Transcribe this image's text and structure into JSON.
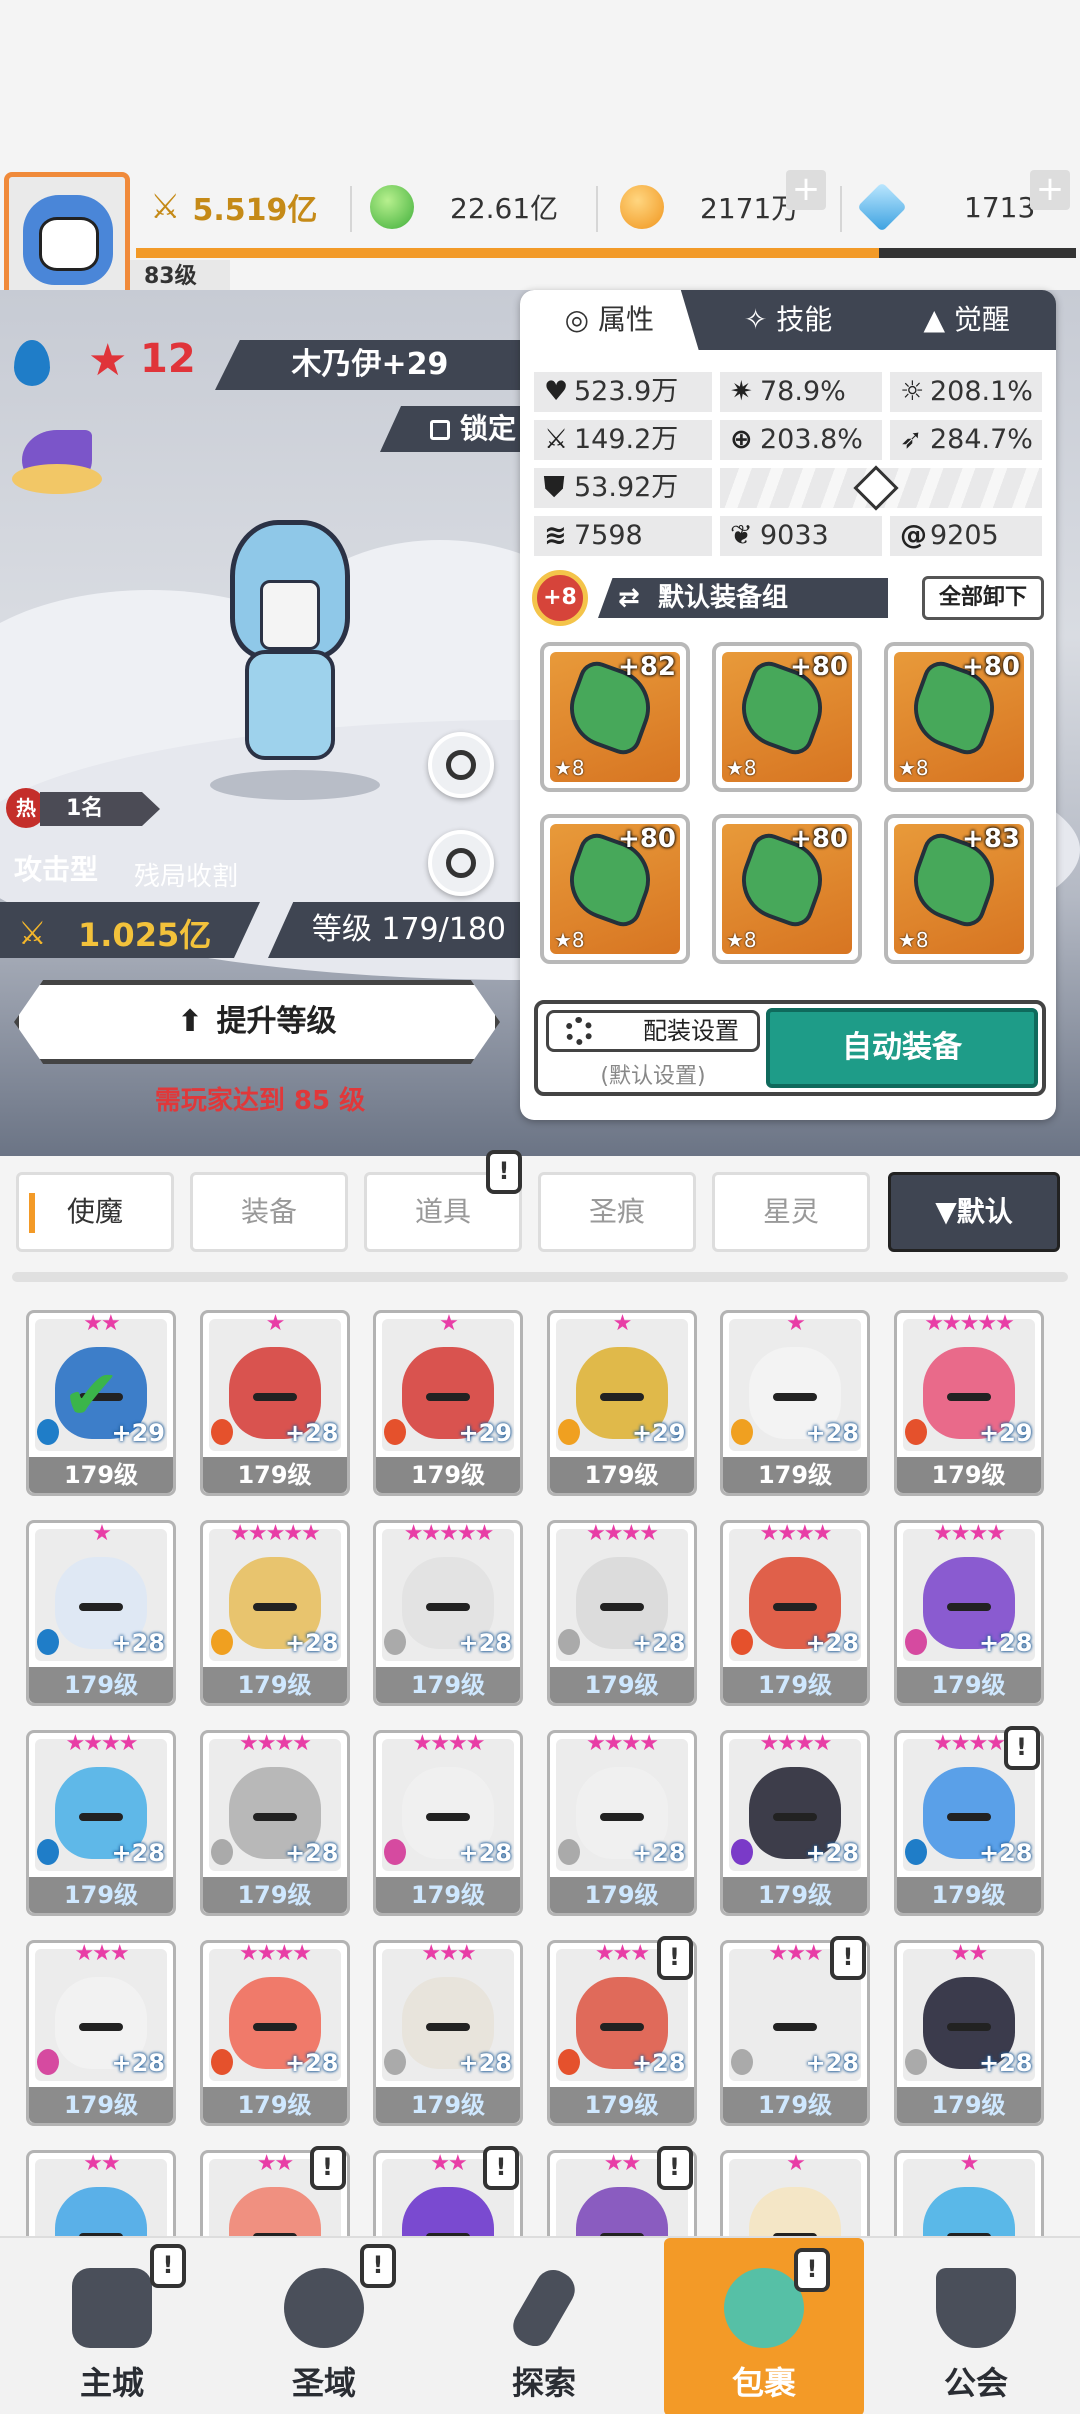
{
  "resources": {
    "power": "5.519亿",
    "gems": "22.61亿",
    "gold": "2171万",
    "crystal": "1713",
    "player_level": "83级",
    "xp_progress": 0.79
  },
  "hero": {
    "star_count": "12",
    "name": "木乃伊+29",
    "lock_label": "锁定",
    "hot_label": "热",
    "rank": "1名",
    "type": "攻击型",
    "subtype": "残局收割",
    "power": "1.025亿",
    "level": "等级 179/180",
    "upgrade_label": "提升等级",
    "requirement": "需玩家达到 85 级"
  },
  "panel": {
    "tabs": [
      "属性",
      "技能",
      "觉醒"
    ],
    "stats": {
      "hp": "523.9万",
      "crit": "78.9%",
      "crit_dmg": "208.1%",
      "atk": "149.2万",
      "accuracy": "203.8%",
      "speed": "284.7%",
      "def": "53.92万",
      "s1": "7598",
      "s2": "9033",
      "s3": "9205"
    },
    "equip_badge": "+8",
    "equip_set_name": "默认装备组",
    "unequip_all": "全部卸下",
    "equip_slots": [
      {
        "plus": "+82",
        "stars": "★8"
      },
      {
        "plus": "+80",
        "stars": "★8"
      },
      {
        "plus": "+80",
        "stars": "★8"
      },
      {
        "plus": "+80",
        "stars": "★8"
      },
      {
        "plus": "+80",
        "stars": "★8"
      },
      {
        "plus": "+83",
        "stars": "★8"
      }
    ],
    "config_label": "配装设置",
    "config_sub": "(默认设置)",
    "auto_equip": "自动装备"
  },
  "category_tabs": [
    "使魔",
    "装备",
    "道具",
    "圣痕",
    "星灵"
  ],
  "sort_label": "▼默认",
  "alert_mark": "!",
  "roster": [
    {
      "level": "179级",
      "plus": "+29",
      "stars": "★★"
    },
    {
      "level": "179级",
      "plus": "+28",
      "stars": "★"
    },
    {
      "level": "179级",
      "plus": "+29",
      "stars": "★"
    },
    {
      "level": "179级",
      "plus": "+29",
      "stars": "★"
    },
    {
      "level": "179级",
      "plus": "+28",
      "stars": "★"
    },
    {
      "level": "179级",
      "plus": "+29",
      "stars": "★★★★★"
    },
    {
      "level": "179级",
      "plus": "+28",
      "stars": "★"
    },
    {
      "level": "179级",
      "plus": "+28",
      "stars": "★★★★★"
    },
    {
      "level": "179级",
      "plus": "+28",
      "stars": "★★★★★"
    },
    {
      "level": "179级",
      "plus": "+28",
      "stars": "★★★★"
    },
    {
      "level": "179级",
      "plus": "+28",
      "stars": "★★★★"
    },
    {
      "level": "179级",
      "plus": "+28",
      "stars": "★★★★"
    },
    {
      "level": "179级",
      "plus": "+28",
      "stars": "★★★★"
    },
    {
      "level": "179级",
      "plus": "+28",
      "stars": "★★★★"
    },
    {
      "level": "179级",
      "plus": "+28",
      "stars": "★★★★"
    },
    {
      "level": "179级",
      "plus": "+28",
      "stars": "★★★★"
    },
    {
      "level": "179级",
      "plus": "+28",
      "stars": "★★★★"
    },
    {
      "level": "179级",
      "plus": "+28",
      "stars": "★★★★"
    },
    {
      "level": "179级",
      "plus": "+28",
      "stars": "★★★"
    },
    {
      "level": "179级",
      "plus": "+28",
      "stars": "★★★★"
    },
    {
      "level": "179级",
      "plus": "+28",
      "stars": "★★★"
    },
    {
      "level": "179级",
      "plus": "+28",
      "stars": "★★★"
    },
    {
      "level": "179级",
      "plus": "+28",
      "stars": "★★★"
    },
    {
      "level": "179级",
      "plus": "+28",
      "stars": "★★"
    },
    {
      "level": "",
      "plus": "",
      "stars": "★★"
    },
    {
      "level": "",
      "plus": "",
      "stars": "★★"
    },
    {
      "level": "",
      "plus": "",
      "stars": "★★"
    },
    {
      "level": "",
      "plus": "",
      "stars": "★★"
    },
    {
      "level": "",
      "plus": "",
      "stars": "★"
    },
    {
      "level": "",
      "plus": "",
      "stars": "★"
    }
  ],
  "nav": [
    "主城",
    "圣域",
    "探索",
    "包裹",
    "公会"
  ],
  "colors": {
    "accent": "#f39a27",
    "dark": "#3f4552",
    "teal": "#1e9c88",
    "red": "#e0383a"
  }
}
